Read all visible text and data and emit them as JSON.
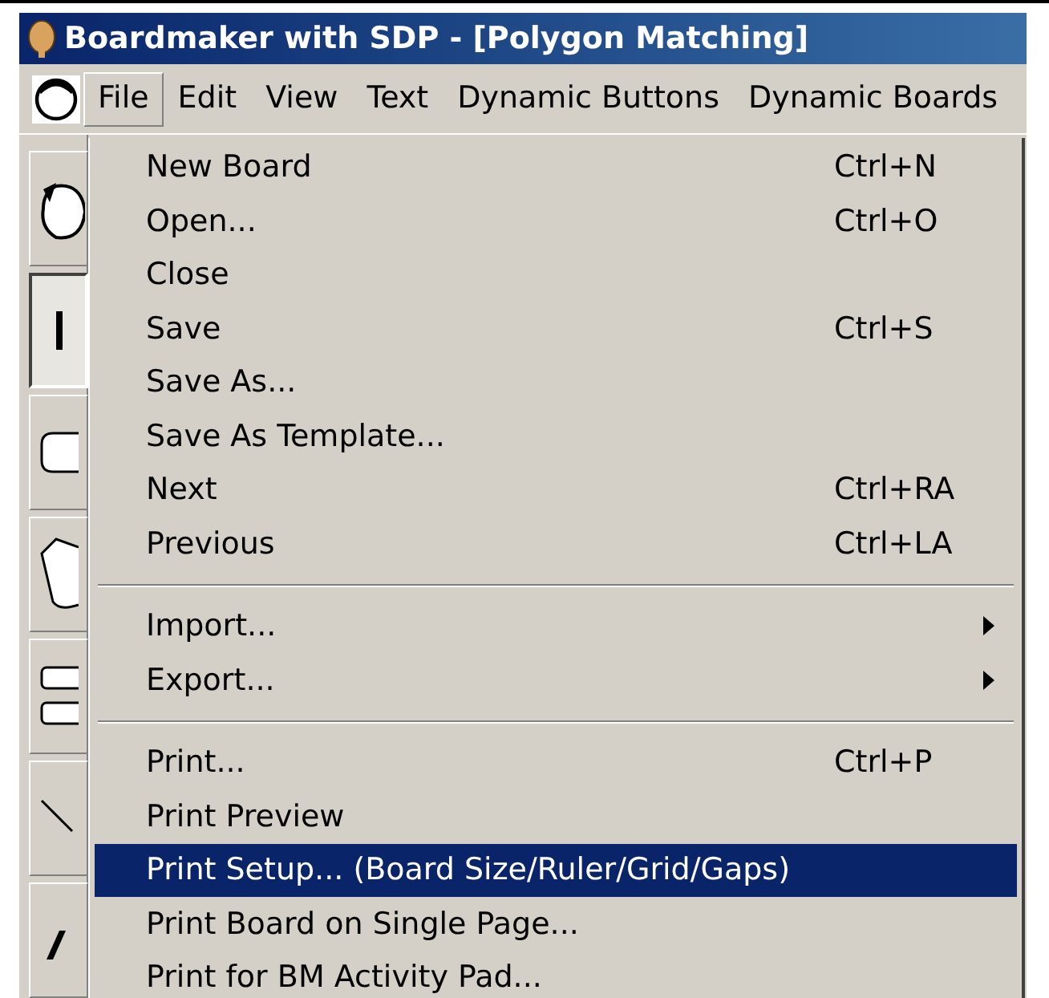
{
  "window": {
    "title": "Boardmaker with SDP - [Polygon Matching]"
  },
  "menu_bar": [
    {
      "label": "File",
      "selected": true
    },
    {
      "label": "Edit",
      "selected": false
    },
    {
      "label": "View",
      "selected": false
    },
    {
      "label": "Text",
      "selected": false
    },
    {
      "label": "Dynamic Buttons",
      "selected": false
    },
    {
      "label": "Dynamic Boards",
      "selected": false
    }
  ],
  "toolbar": [
    {
      "kind": "face",
      "selected": false
    },
    {
      "kind": "pointer",
      "selected": true
    },
    {
      "kind": "rounded-rect",
      "selected": false
    },
    {
      "kind": "polygon",
      "selected": false
    },
    {
      "kind": "two-rects",
      "selected": false
    },
    {
      "kind": "line",
      "selected": false
    },
    {
      "kind": "pencil",
      "selected": false
    }
  ],
  "file_menu": [
    {
      "kind": "item",
      "label": "New Board",
      "shortcut": "Ctrl+N",
      "selected": false
    },
    {
      "kind": "item",
      "label": "Open...",
      "shortcut": "Ctrl+O",
      "selected": false
    },
    {
      "kind": "item",
      "label": "Close",
      "selected": false
    },
    {
      "kind": "item",
      "label": "Save",
      "shortcut": "Ctrl+S",
      "selected": false
    },
    {
      "kind": "item",
      "label": "Save As...",
      "selected": false
    },
    {
      "kind": "item",
      "label": "Save As Template...",
      "selected": false
    },
    {
      "kind": "item",
      "label": "Next",
      "shortcut": "Ctrl+RA",
      "selected": false
    },
    {
      "kind": "item",
      "label": "Previous",
      "shortcut": "Ctrl+LA",
      "selected": false
    },
    {
      "kind": "separator"
    },
    {
      "kind": "submenu",
      "label": "Import...",
      "selected": false
    },
    {
      "kind": "submenu",
      "label": "Export...",
      "selected": false
    },
    {
      "kind": "separator"
    },
    {
      "kind": "item",
      "label": "Print...",
      "shortcut": "Ctrl+P",
      "selected": false
    },
    {
      "kind": "item",
      "label": "Print Preview",
      "selected": false
    },
    {
      "kind": "item",
      "label": "Print Setup... (Board Size/Ruler/Grid/Gaps)",
      "selected": true
    },
    {
      "kind": "item",
      "label": "Print Board on Single Page...",
      "selected": false
    },
    {
      "kind": "item",
      "label": "Print for BM Activity Pad...",
      "selected": false
    }
  ]
}
